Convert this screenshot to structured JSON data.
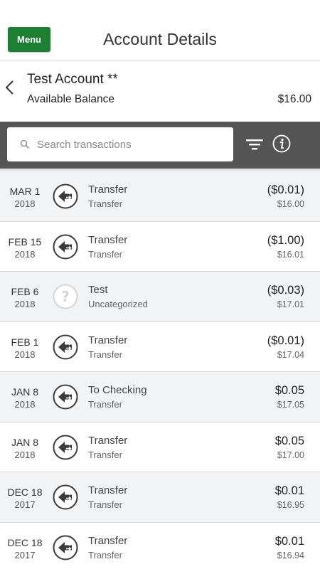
{
  "header": {
    "menu_label": "Menu",
    "title": "Account Details"
  },
  "account": {
    "name": "Test Account **",
    "balance_label": "Available Balance",
    "balance": "$16.00"
  },
  "search": {
    "placeholder": "Search transactions",
    "value": ""
  },
  "icons": {
    "back": "chevron-left-icon",
    "search": "search-icon",
    "filter": "filter-icon",
    "info": "info-icon",
    "transfer": "transfer-icon",
    "uncategorized": "question-icon"
  },
  "colors": {
    "accent": "#1e7e34",
    "toolbar": "#555555"
  },
  "transactions": [
    {
      "date": "MAR 1",
      "year": "2018",
      "description": "Transfer",
      "category": "Transfer",
      "amount": "($0.01)",
      "running_balance": "$16.00",
      "icon": "transfer"
    },
    {
      "date": "FEB 15",
      "year": "2018",
      "description": "Transfer",
      "category": "Transfer",
      "amount": "($1.00)",
      "running_balance": "$16.01",
      "icon": "transfer"
    },
    {
      "date": "FEB 6",
      "year": "2018",
      "description": "Test",
      "category": "Uncategorized",
      "amount": "($0.03)",
      "running_balance": "$17.01",
      "icon": "uncategorized"
    },
    {
      "date": "FEB 1",
      "year": "2018",
      "description": "Transfer",
      "category": "Transfer",
      "amount": "($0.01)",
      "running_balance": "$17.04",
      "icon": "transfer"
    },
    {
      "date": "JAN 8",
      "year": "2018",
      "description": "To Checking",
      "category": "Transfer",
      "amount": "$0.05",
      "running_balance": "$17.05",
      "icon": "transfer"
    },
    {
      "date": "JAN 8",
      "year": "2018",
      "description": "Transfer",
      "category": "Transfer",
      "amount": "$0.05",
      "running_balance": "$17.00",
      "icon": "transfer"
    },
    {
      "date": "DEC 18",
      "year": "2017",
      "description": "Transfer",
      "category": "Transfer",
      "amount": "$0.01",
      "running_balance": "$16.95",
      "icon": "transfer"
    },
    {
      "date": "DEC 18",
      "year": "2017",
      "description": "Transfer",
      "category": "Transfer",
      "amount": "$0.01",
      "running_balance": "$16.94",
      "icon": "transfer"
    }
  ]
}
